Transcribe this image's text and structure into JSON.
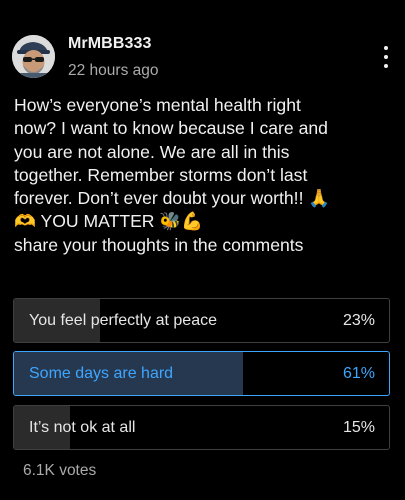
{
  "post": {
    "author": "MrMBB333",
    "time": "22 hours ago",
    "body_lines": [
      "How’s everyone’s mental health right",
      "now? I want to know because I care and",
      "you are not alone. We are all in this",
      "together. Remember storms don’t last",
      "forever. Don’t ever doubt your worth!! 🙏",
      "🫶  YOU MATTER 🐝💪",
      "share your thoughts in the comments"
    ]
  },
  "poll": {
    "options": [
      {
        "label": "You feel perfectly at peace",
        "percent": "23%",
        "fill": 0.23,
        "selected": false
      },
      {
        "label": "Some days are hard",
        "percent": "61%",
        "fill": 0.61,
        "selected": true
      },
      {
        "label": "It’s not ok at all",
        "percent": "15%",
        "fill": 0.15,
        "selected": false
      }
    ],
    "votes": "6.1K votes"
  },
  "icons": {
    "menu": "more-vert-icon"
  },
  "colors": {
    "background": "#000000",
    "accent": "#3ea6ff",
    "selected_fill": "#263850",
    "option_fill": "#2b2b2b"
  }
}
